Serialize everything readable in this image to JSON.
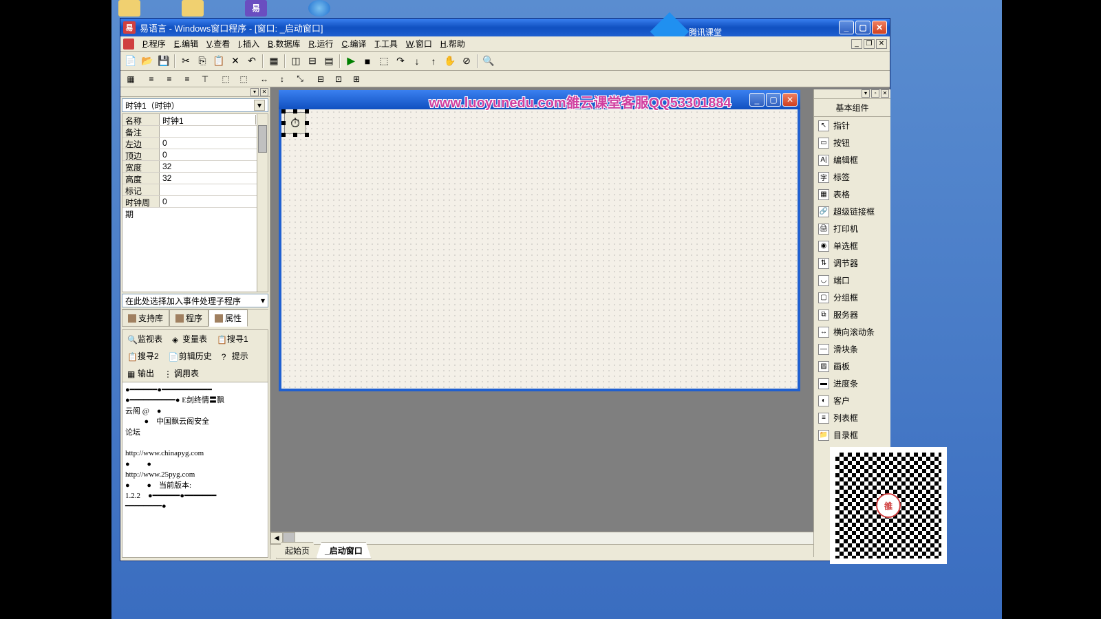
{
  "title": "易语言  -  Windows窗口程序  -  [窗口: _启动窗口]",
  "brand_text": "腾讯课堂",
  "watermark": "www.luoyunedu.com雒云课堂客服QQ53301884",
  "menus": [
    {
      "key": "程序",
      "u": "P"
    },
    {
      "key": "编辑",
      "u": "E"
    },
    {
      "key": "查看",
      "u": "V"
    },
    {
      "key": "插入",
      "u": "I"
    },
    {
      "key": "数据库",
      "u": "B"
    },
    {
      "key": "运行",
      "u": "R"
    },
    {
      "key": "编译",
      "u": "C"
    },
    {
      "key": "工具",
      "u": "T"
    },
    {
      "key": "窗口",
      "u": "W"
    },
    {
      "key": "帮助",
      "u": "H"
    }
  ],
  "prop_selector": "时钟1（时钟）",
  "props": [
    {
      "name": "名称",
      "val": "时钟1",
      "dd": true
    },
    {
      "name": "备注",
      "val": ""
    },
    {
      "name": "左边",
      "val": "0"
    },
    {
      "name": "顶边",
      "val": "0"
    },
    {
      "name": "宽度",
      "val": "32"
    },
    {
      "name": "高度",
      "val": "32"
    },
    {
      "name": "标记",
      "val": ""
    },
    {
      "name": "时钟周期",
      "val": "0"
    }
  ],
  "event_selector": "在此处选择加入事件处理子程序",
  "left_tabs": [
    {
      "label": "支持库"
    },
    {
      "label": "程序"
    },
    {
      "label": "属性",
      "active": true
    }
  ],
  "lower_tabs": [
    {
      "label": "监视表",
      "icon": "🔍"
    },
    {
      "label": "变量表",
      "icon": "◈"
    },
    {
      "label": "搜寻1",
      "icon": "📋"
    },
    {
      "label": "搜寻2",
      "icon": "📋"
    },
    {
      "label": "剪辑历史",
      "icon": "📄"
    },
    {
      "label": "提示",
      "icon": "?"
    },
    {
      "label": "输出",
      "icon": "▦"
    },
    {
      "label": "调用表",
      "icon": "⋮⋮⋮"
    }
  ],
  "lower_content": "●━━━━━━●━━━━━━━━━━━\n●━━━━━━━━━━● E剑终情〓飘\n云阁 @    ●\n          ●    中国飘云阁安全\n论坛\n\nhttp://www.chinapyg.com\n●         ●\nhttp://www.25pyg.com\n●         ●    当前版本:\n1.2.2    ●━━━━━━●━━━━━━━\n━━━━━━━━●",
  "bottom_tabs": [
    {
      "label": "起始页"
    },
    {
      "label": "_启动窗口",
      "active": true
    }
  ],
  "right_title": "基本组件",
  "components": [
    {
      "label": "指针",
      "icon": "↖"
    },
    {
      "label": "按钮",
      "icon": "▭"
    },
    {
      "label": "编辑框",
      "icon": "A|"
    },
    {
      "label": "标签",
      "icon": "字"
    },
    {
      "label": "表格",
      "icon": "▦"
    },
    {
      "label": "超级链接框",
      "icon": "🔗"
    },
    {
      "label": "打印机",
      "icon": "🖨"
    },
    {
      "label": "单选框",
      "icon": "◉"
    },
    {
      "label": "调节器",
      "icon": "⇅"
    },
    {
      "label": "端口",
      "icon": "◡"
    },
    {
      "label": "分组框",
      "icon": "▢"
    },
    {
      "label": "服务器",
      "icon": "⧉"
    },
    {
      "label": "横向滚动条",
      "icon": "↔"
    },
    {
      "label": "滑块条",
      "icon": "—"
    },
    {
      "label": "画板",
      "icon": "▨"
    },
    {
      "label": "进度条",
      "icon": "▬"
    },
    {
      "label": "客户",
      "icon": "◐"
    },
    {
      "label": "列表框",
      "icon": "≡"
    },
    {
      "label": "目录框",
      "icon": "📁"
    }
  ],
  "qr_center": "雒"
}
